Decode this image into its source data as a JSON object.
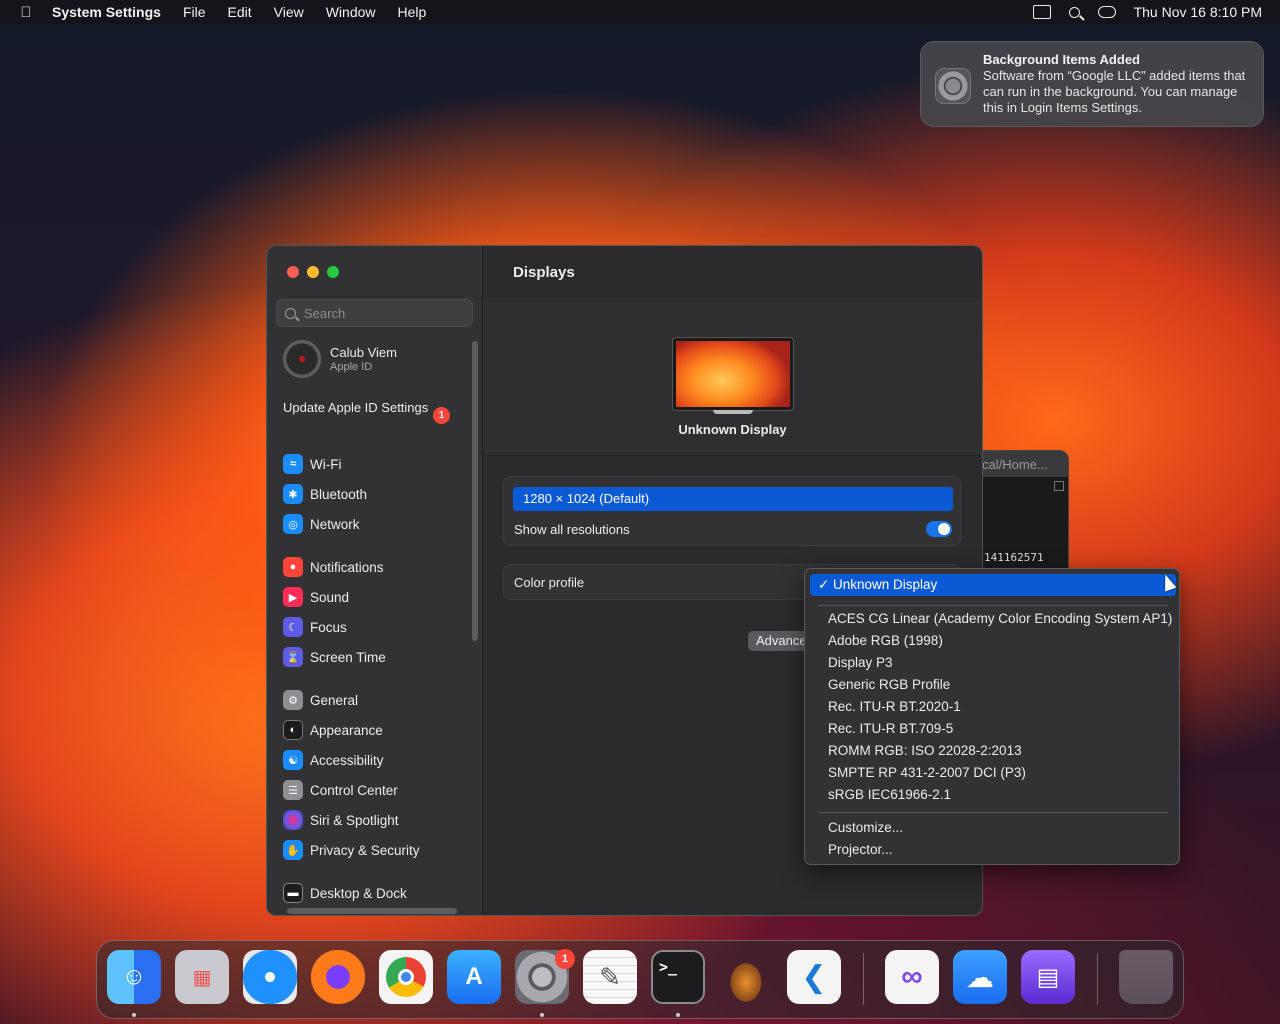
{
  "menubar": {
    "app_name": "System Settings",
    "menus": [
      "File",
      "Edit",
      "View",
      "Window",
      "Help"
    ],
    "clock": "Thu Nov 16  8:10 PM"
  },
  "notification": {
    "title": "Background Items Added",
    "body": "Software from “Google LLC” added items that can run in the background. You can manage this in Login Items Settings."
  },
  "terminal_peek": {
    "title": "cal/Home...",
    "line": "141162571"
  },
  "sidebar": {
    "search_placeholder": "Search",
    "account_name": "Calub Viem",
    "account_sub": "Apple ID",
    "update_label": "Update Apple ID Settings",
    "update_badge": "1",
    "items": [
      {
        "label": "Wi-Fi",
        "icon": "wifi-icon",
        "color": "#1a8cff"
      },
      {
        "label": "Bluetooth",
        "icon": "bluetooth-icon",
        "color": "#1a8cff"
      },
      {
        "label": "Network",
        "icon": "globe-icon",
        "color": "#1a8cff"
      },
      {
        "label": "Notifications",
        "icon": "bell-icon",
        "color": "#ff453a"
      },
      {
        "label": "Sound",
        "icon": "speaker-icon",
        "color": "#ff2d55"
      },
      {
        "label": "Focus",
        "icon": "moon-icon",
        "color": "#5e5ce6"
      },
      {
        "label": "Screen Time",
        "icon": "hourglass-icon",
        "color": "#5e5ce6"
      },
      {
        "label": "General",
        "icon": "gear-icon",
        "color": "#8e8e93"
      },
      {
        "label": "Appearance",
        "icon": "appearance-icon",
        "color": "#1c1c1e"
      },
      {
        "label": "Accessibility",
        "icon": "accessibility-icon",
        "color": "#1a8cff"
      },
      {
        "label": "Control Center",
        "icon": "control-center-icon",
        "color": "#8e8e93"
      },
      {
        "label": "Siri & Spotlight",
        "icon": "siri-icon",
        "color": "#bf5af2"
      },
      {
        "label": "Privacy & Security",
        "icon": "hand-icon",
        "color": "#1a8cff"
      },
      {
        "label": "Desktop & Dock",
        "icon": "dock-icon",
        "color": "#1c1c1e"
      }
    ]
  },
  "content": {
    "title": "Displays",
    "display_name": "Unknown Display",
    "resolution_selected": "1280 × 1024 (Default)",
    "show_all_resolutions": "Show all resolutions",
    "show_all_resolutions_on": true,
    "color_profile_label": "Color profile",
    "advanced_label": "Advanced..."
  },
  "dropdown": {
    "selected": "Unknown Display",
    "options": [
      "ACES CG Linear (Academy Color Encoding System AP1)",
      "Adobe RGB (1998)",
      "Display P3",
      "Generic RGB Profile",
      "Rec. ITU-R BT.2020-1",
      "Rec. ITU-R BT.709-5",
      "ROMM RGB: ISO 22028-2:2013",
      "SMPTE RP 431-2-2007 DCI (P3)",
      "sRGB IEC61966-2.1"
    ],
    "actions": [
      "Customize...",
      "Projector..."
    ]
  },
  "dock": {
    "apps": [
      {
        "name": "finder-icon",
        "color": "#2a8ff7"
      },
      {
        "name": "launchpad-icon",
        "color": "#c9c9cf"
      },
      {
        "name": "safari-icon",
        "color": "#1e90ff"
      },
      {
        "name": "firefox-icon",
        "color": "#ff7a1a"
      },
      {
        "name": "chrome-icon",
        "color": "#f4f4f4"
      },
      {
        "name": "app-store-icon",
        "color": "#1a8cff"
      },
      {
        "name": "system-settings-icon",
        "color": "#8e8e93"
      },
      {
        "name": "textedit-icon",
        "color": "#f4f4f4"
      },
      {
        "name": "terminal-icon",
        "color": "#1c1c1e"
      },
      {
        "name": "garageband-icon",
        "color": "#2c2c2e"
      },
      {
        "name": "vscode-icon",
        "color": "#f4f4f4"
      },
      {
        "name": "visual-studio-icon",
        "color": "#f4f4f4"
      },
      {
        "name": "weather-icon",
        "color": "#2a8ff7"
      },
      {
        "name": "archive-icon",
        "color": "#7d4cf0"
      },
      {
        "name": "trash-icon",
        "color": "#6a6a70"
      }
    ],
    "settings_badge": "1",
    "terminal_glyph": ">_"
  }
}
